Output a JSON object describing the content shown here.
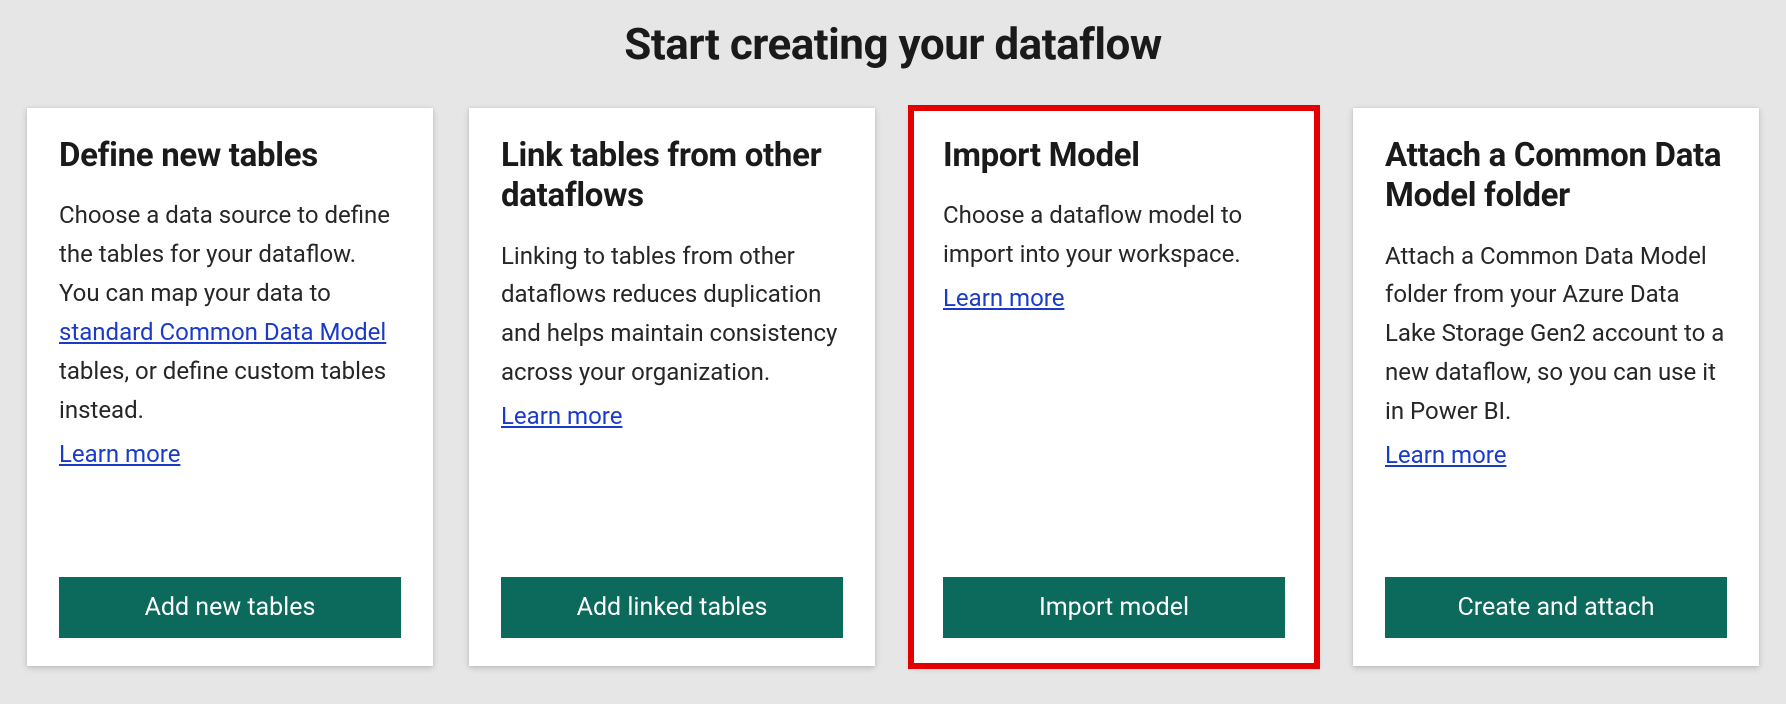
{
  "title": "Start creating your dataflow",
  "learn_more_label": "Learn more",
  "cards": [
    {
      "title": "Define new tables",
      "desc_before": "Choose a data source to define the tables for your dataflow. You can map your data to ",
      "desc_link": "standard Common Data Model",
      "desc_after": " tables, or define custom tables instead.",
      "button": "Add new tables"
    },
    {
      "title": "Link tables from other dataflows",
      "desc": "Linking to tables from other dataflows reduces duplication and helps maintain consistency across your organization.",
      "button": "Add linked tables"
    },
    {
      "title": "Import Model",
      "desc": "Choose a dataflow model to import into your workspace.",
      "button": "Import model"
    },
    {
      "title": "Attach a Common Data Model folder",
      "desc": "Attach a Common Data Model folder from your Azure Data Lake Storage Gen2 account to a new dataflow, so you can use it in Power BI.",
      "button": "Create and attach"
    }
  ]
}
